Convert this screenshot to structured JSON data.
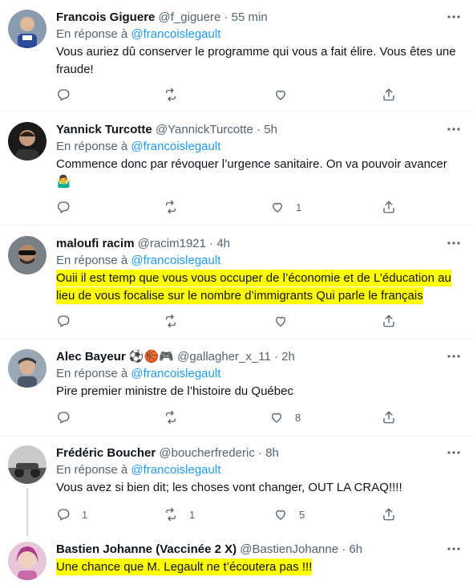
{
  "tweets": [
    {
      "name": "Francois Giguere",
      "handle": "@f_giguere",
      "time": "55 min",
      "reply_prefix": "En réponse à",
      "reply_to": "@francoislegault",
      "text_lines": [
        "Vous auriez dû conserver le programme qui vous a fait élire. Vous êtes une",
        "fraude!"
      ],
      "replies": "",
      "retweets": "",
      "likes": ""
    },
    {
      "name": "Yannick Turcotte",
      "handle": "@YannickTurcotte",
      "time": "5h",
      "reply_prefix": "En réponse à",
      "reply_to": "@francoislegault",
      "text_lines": [
        "Commence donc par révoquer l’urgence sanitaire. On va pouvoir avancer",
        "🤷‍♂️"
      ],
      "replies": "",
      "retweets": "",
      "likes": "1"
    },
    {
      "name": "maloufi racim",
      "handle": "@racim1921",
      "time": "4h",
      "reply_prefix": "En réponse à",
      "reply_to": "@francoislegault",
      "text_lines": [
        "Ouii il est temp que vous vous occuper de l’économie et de L’éducation au",
        "lieu de vous focalise sur le nombre d’immigrants Qui parle le français"
      ],
      "replies": "",
      "retweets": "",
      "likes": ""
    },
    {
      "name": "Alec Bayeur",
      "name_emoji": "⚽🏀🎮",
      "handle": "@gallagher_x_11",
      "time": "2h",
      "reply_prefix": "En réponse à",
      "reply_to": "@francoislegault",
      "text_lines": [
        "Pire premier ministre de l’histoire du Québec"
      ],
      "replies": "",
      "retweets": "",
      "likes": "8"
    },
    {
      "name": "Frédéric Boucher",
      "handle": "@boucherfrederic",
      "time": "8h",
      "reply_prefix": "En réponse à",
      "reply_to": "@francoislegault",
      "text_lines": [
        "Vous avez si bien dit; les choses vont changer, OUT LA CRAQ!!!!"
      ],
      "replies": "1",
      "retweets": "1",
      "likes": "5"
    },
    {
      "name": "Bastien Johanne (Vaccinée 2 X)",
      "handle": "@BastienJohanne",
      "time": "6h",
      "text_lines": [
        "Une chance que M. Legault ne t’écoutera pas !!!"
      ]
    }
  ],
  "separator": "·",
  "colors": {
    "accent": "#1d9bf0",
    "secondary_text": "#536471",
    "highlight": "#ffff00",
    "border": "#eff3f4"
  },
  "icons": {
    "reply": "reply-icon",
    "retweet": "retweet-icon",
    "like": "heart-icon",
    "share": "share-icon",
    "more": "more-icon"
  }
}
